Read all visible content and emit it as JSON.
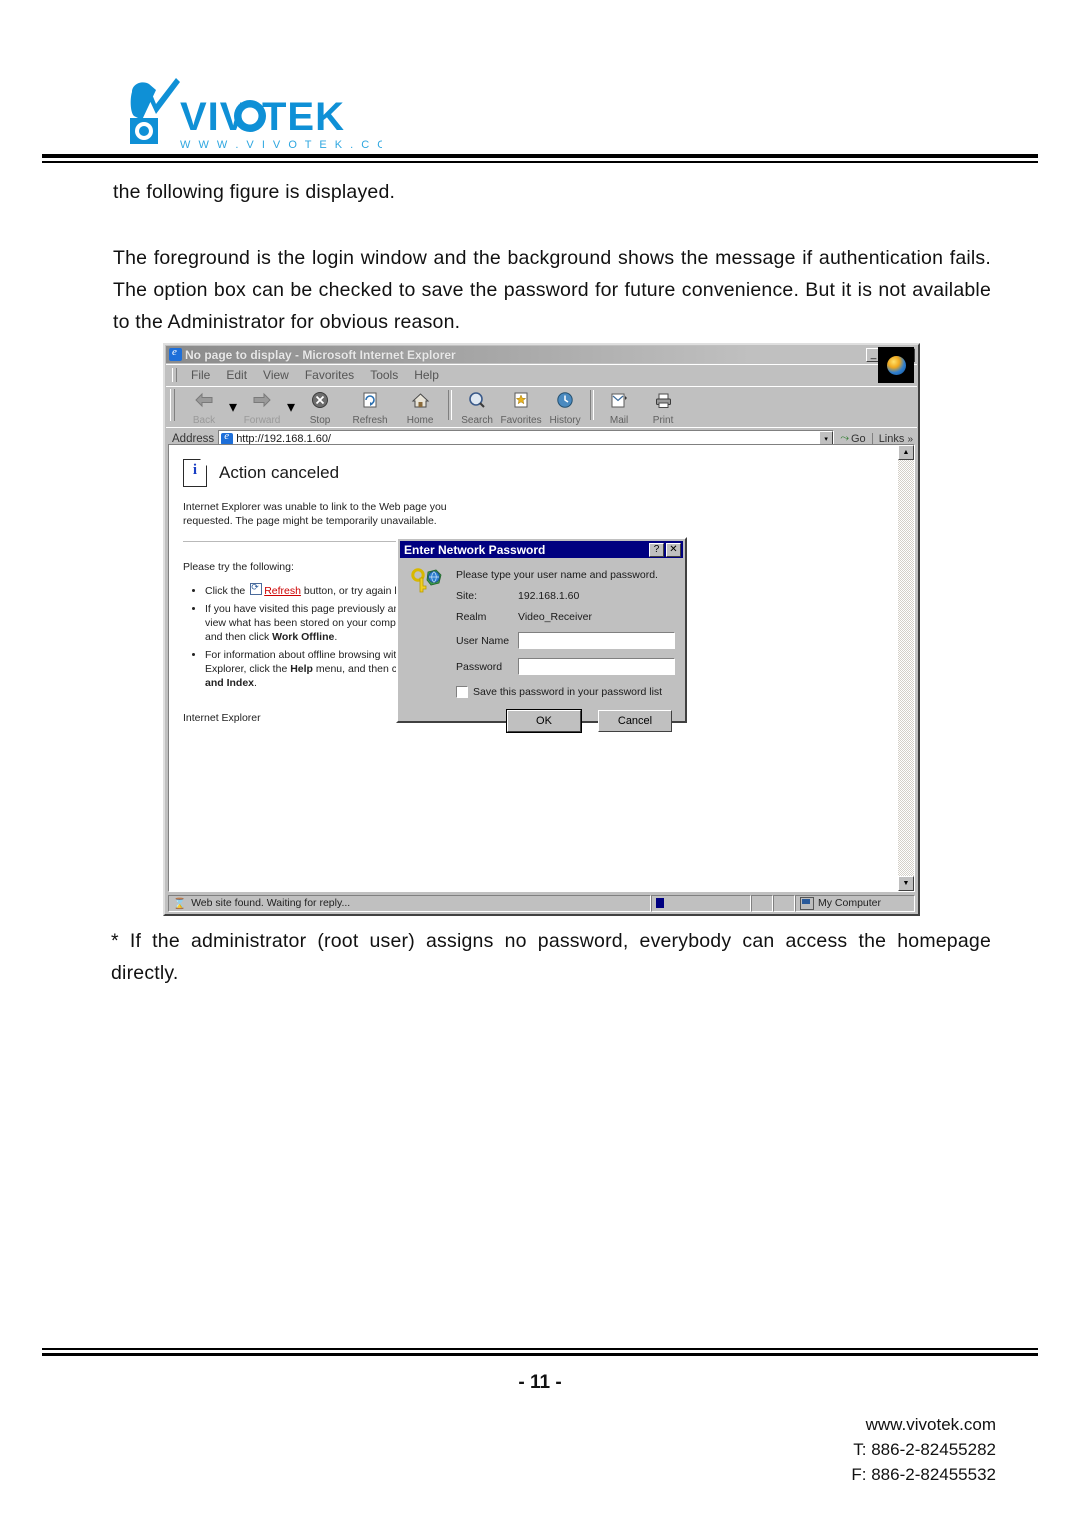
{
  "header": {
    "brand": "VIVOTEK",
    "brand_url": "w w w . v i v o t e k . c o m",
    "brand_color": "#0f90d6"
  },
  "document": {
    "para_1": "the following figure is displayed.",
    "para_2": "The foreground is the login window and the background shows the message if authentication fails. The option box can be checked to save the password for future convenience.   But it is not available to the Administrator for obvious reason.",
    "para_3": "* If the administrator (root user) assigns no password, everybody can access the homepage directly."
  },
  "browser": {
    "title": "No page to display - Microsoft Internet Explorer",
    "window_buttons": {
      "minimize": "_",
      "restore": "❐",
      "close": "✕"
    },
    "menu": [
      "File",
      "Edit",
      "View",
      "Favorites",
      "Tools",
      "Help"
    ],
    "toolbar": [
      {
        "label": "Back",
        "icon": "arrow-left-icon",
        "disabled": true
      },
      {
        "label": "Forward",
        "icon": "arrow-right-icon",
        "disabled": true
      },
      {
        "label": "Stop",
        "icon": "stop-icon",
        "disabled": false
      },
      {
        "label": "Refresh",
        "icon": "refresh-icon",
        "disabled": false
      },
      {
        "label": "Home",
        "icon": "home-icon",
        "disabled": false
      },
      {
        "label": "Search",
        "icon": "search-icon",
        "disabled": false
      },
      {
        "label": "Favorites",
        "icon": "favorites-star-icon",
        "disabled": false
      },
      {
        "label": "History",
        "icon": "history-clock-icon",
        "disabled": false
      },
      {
        "label": "Mail",
        "icon": "mail-icon",
        "disabled": false
      },
      {
        "label": "Print",
        "icon": "printer-icon",
        "disabled": false
      }
    ],
    "address": {
      "label": "Address",
      "value": "http://192.168.1.60/",
      "go_label": "Go",
      "links_label": "Links"
    },
    "status": {
      "message": "Web site found. Waiting for reply...",
      "zone": "My Computer"
    }
  },
  "page": {
    "error_title": "Action canceled",
    "error_body": "Internet Explorer was unable to link to the Web page you requested. The page might be temporarily unavailable.",
    "try_label": "Please try the following:",
    "bullets": [
      {
        "pre": "Click the ",
        "icon": "refresh-icon",
        "link": "Refresh",
        "post": " button, or try again later."
      },
      {
        "pre": "If you have visited this page previously and want to view what has been stored on your computer, click File, and then click ",
        "bold": "Work Offline",
        "post": "."
      },
      {
        "pre": "For information about offline browsing with Internet Explorer, click the ",
        "bold": "Help",
        "mid": " menu, and then click ",
        "bold2": "Contents and Index",
        "post": "."
      }
    ],
    "footer": "Internet Explorer"
  },
  "dialog": {
    "title": "Enter Network Password",
    "help_button": "?",
    "close_button": "✕",
    "icon": "key-and-globe-icon",
    "prompt": "Please type your user name and password.",
    "site_label": "Site:",
    "site_value": "192.168.1.60",
    "realm_label": "Realm",
    "realm_value": "Video_Receiver",
    "username_label": "User Name",
    "username_value": "",
    "password_label": "Password",
    "password_value": "",
    "save_label": "Save this password in your password list",
    "save_checked": false,
    "ok_label": "OK",
    "cancel_label": "Cancel"
  },
  "footer": {
    "page_number": "- 11 -",
    "website": "www.vivotek.com",
    "tel": "T: 886-2-82455282",
    "fax": "F: 886-2-82455532"
  }
}
